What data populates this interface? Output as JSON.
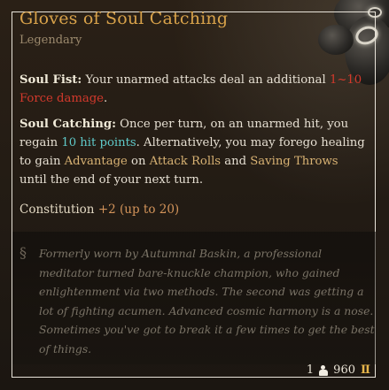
{
  "item": {
    "name": "Gloves of Soul Catching",
    "rarity": "Legendary"
  },
  "effects": {
    "soul_fist": {
      "name": "Soul Fist:",
      "text_before": " Your unarmed attacks deal an additional ",
      "damage": "1~10 Force damage",
      "text_after": "."
    },
    "soul_catching": {
      "name": "Soul Catching:",
      "text_1": " Once per turn, on an unarmed hit, you regain ",
      "healing": "10 hit points",
      "text_2": ". Alternatively, you may forego healing to gain ",
      "advantage": "Advantage",
      "text_3": " on ",
      "attack_rolls": "Attack Rolls",
      "text_4": " and ",
      "saving_throws": "Saving Throws",
      "text_5": " until the end of your next turn."
    }
  },
  "ability": {
    "name": "Constitution",
    "bonus": "+2",
    "cap": "(up to 20)"
  },
  "lore": "Formerly worn by Autumnal Baskin, a professional meditator turned bare-knuckle champion, who gained enlightenment via two methods. The second was getting a lot of fighting acumen. Advanced cosmic harmony is a nose. Sometimes you've got to break it a few times to get the best of things.",
  "footer": {
    "weight": "1",
    "value": "960"
  },
  "icons": {
    "lore": "lore-quill-icon",
    "weight": "weight-icon",
    "value": "gold-coin-icon"
  },
  "colors": {
    "title": "#d8a24a",
    "damage": "#d2392c",
    "healing": "#5fc9c9",
    "keyword": "#d8b273",
    "bonus": "#d3945a"
  }
}
